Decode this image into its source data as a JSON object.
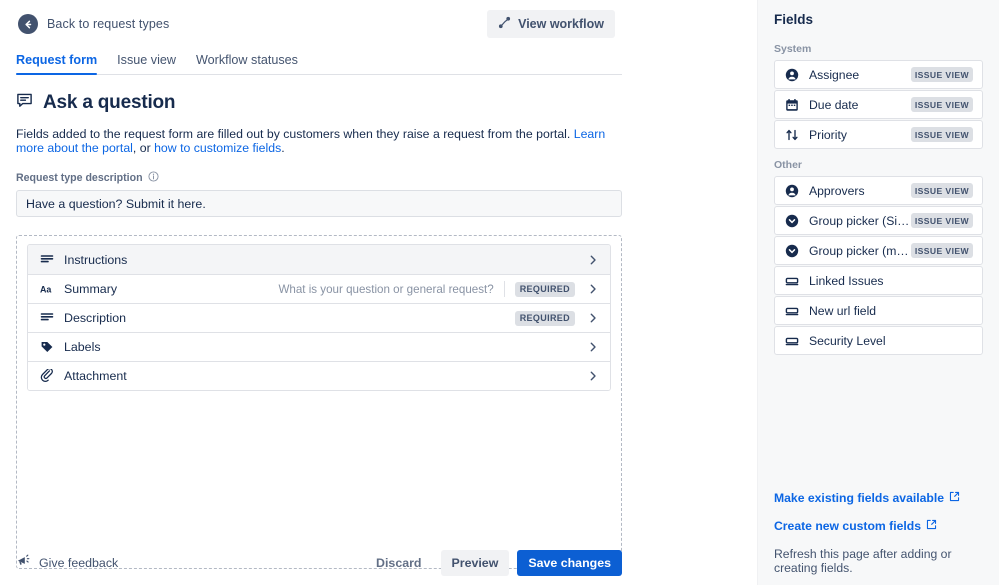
{
  "topbar": {
    "back_label": "Back to request types",
    "back_icon": "arrow-left-circle-icon",
    "view_workflow_label": "View workflow",
    "view_workflow_icon": "workflow-icon"
  },
  "tabs": [
    {
      "label": "Request form",
      "active": true
    },
    {
      "label": "Issue view",
      "active": false
    },
    {
      "label": "Workflow statuses",
      "active": false
    }
  ],
  "header": {
    "icon": "comment-bubble-icon",
    "title": "Ask a question"
  },
  "description": {
    "text_before": "Fields added to the request form are filled out by customers when they raise a request from the portal. ",
    "link1": "Learn more about the portal",
    "text_mid": ", or ",
    "link2": "how to customize fields",
    "text_after": "."
  },
  "request_type_description": {
    "label": "Request type description",
    "info_icon": "info-circle-icon",
    "value": "Have a question? Submit it here.",
    "placeholder": "Have a question? Submit it here."
  },
  "form_rows": [
    {
      "name": "Instructions",
      "icon": "paragraph-lines-icon",
      "hint": "",
      "required": false,
      "highlighted": true
    },
    {
      "name": "Summary",
      "icon": "text-aa-icon",
      "hint": "What is your question or general request?",
      "required": true,
      "highlighted": false
    },
    {
      "name": "Description",
      "icon": "paragraph-lines-icon",
      "hint": "",
      "required": true,
      "highlighted": false
    },
    {
      "name": "Labels",
      "icon": "tag-icon",
      "hint": "",
      "required": false,
      "highlighted": false
    },
    {
      "name": "Attachment",
      "icon": "paperclip-icon",
      "hint": "",
      "required": false,
      "highlighted": false
    }
  ],
  "badges": {
    "required": "REQUIRED",
    "issue_view": "ISSUE VIEW"
  },
  "footer": {
    "feedback_icon": "megaphone-icon",
    "feedback_label": "Give feedback",
    "discard_label": "Discard",
    "preview_label": "Preview",
    "save_label": "Save changes"
  },
  "sidebar": {
    "title": "Fields",
    "groups": [
      {
        "label": "System",
        "items": [
          {
            "name": "Assignee",
            "icon": "person-circle-icon",
            "badge": "ISSUE VIEW"
          },
          {
            "name": "Due date",
            "icon": "calendar-icon",
            "badge": "ISSUE VIEW"
          },
          {
            "name": "Priority",
            "icon": "arrows-up-down-icon",
            "badge": "ISSUE VIEW"
          }
        ]
      },
      {
        "label": "Other",
        "items": [
          {
            "name": "Approvers",
            "icon": "person-circle-icon",
            "badge": "ISSUE VIEW"
          },
          {
            "name": "Group picker (Single group)",
            "icon": "chevron-circle-down-icon",
            "badge": "ISSUE VIEW"
          },
          {
            "name": "Group picker (multiple group...",
            "icon": "chevron-circle-down-icon",
            "badge": "ISSUE VIEW"
          },
          {
            "name": "Linked Issues",
            "icon": "text-field-icon",
            "badge": ""
          },
          {
            "name": "New url field",
            "icon": "text-field-icon",
            "badge": ""
          },
          {
            "name": "Security Level",
            "icon": "text-field-icon",
            "badge": ""
          }
        ]
      }
    ],
    "footer": {
      "link1": "Make existing fields available",
      "link2": "Create new custom fields",
      "note": "Refresh this page after adding or creating fields.",
      "external_icon": "external-link-icon"
    }
  },
  "colors": {
    "accent": "#0C66E4",
    "primary_button": "#0C5FD3",
    "text": "#172B4D",
    "subtle_text": "#626F86",
    "sidebar_bg": "#F7F8F9",
    "badge_bg": "#DCDFE4"
  }
}
